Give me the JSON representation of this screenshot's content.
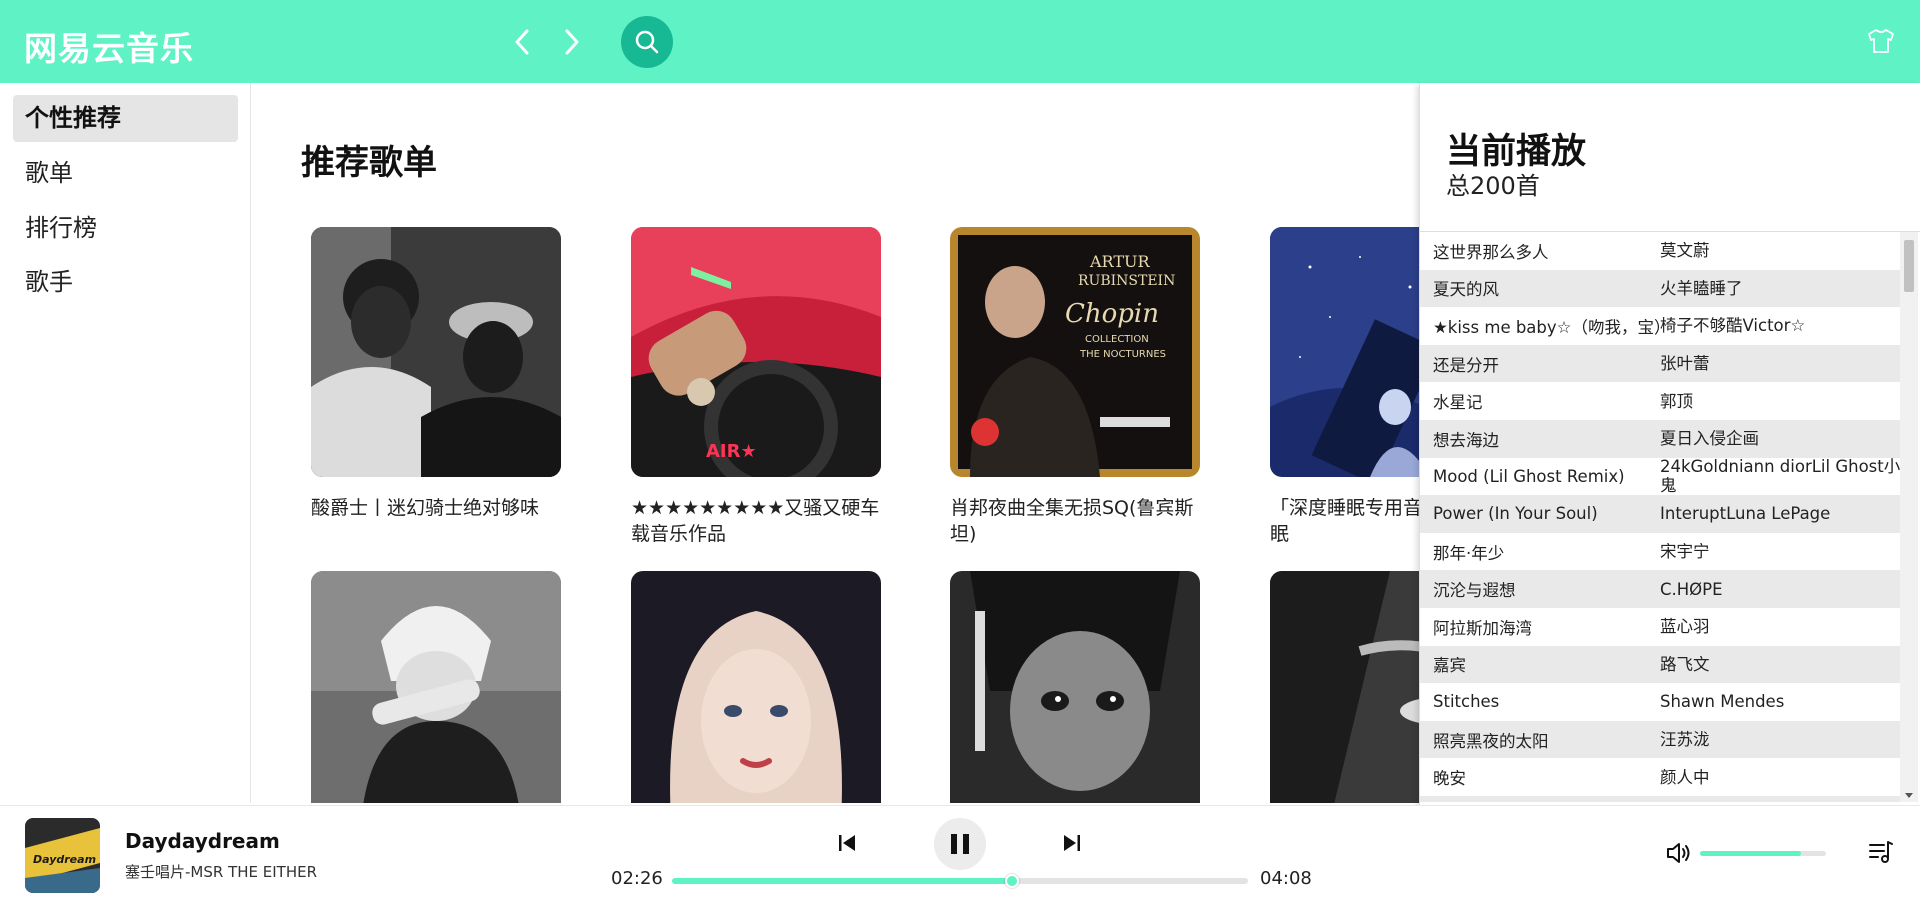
{
  "header": {
    "logo": "网易云音乐",
    "back_icon": "chevron-left-icon",
    "forward_icon": "chevron-right-icon",
    "search_icon": "search-icon",
    "skin_icon": "tshirt-icon",
    "bg_color": "#5ef2c4",
    "search_bg_color": "#17b995"
  },
  "sidebar": {
    "items": [
      {
        "label": "个性推荐",
        "active": true
      },
      {
        "label": "歌单",
        "active": false
      },
      {
        "label": "排行榜",
        "active": false
      },
      {
        "label": "歌手",
        "active": false
      }
    ]
  },
  "main": {
    "section_title": "推荐歌单",
    "playlists": [
      {
        "title": "酸爵士丨迷幻骑士绝对够味"
      },
      {
        "title": "★★★★★★★★★又骚又硬车载音乐作品"
      },
      {
        "title": "肖邦夜曲全集无损SQ(鲁宾斯坦)"
      },
      {
        "title": "「深度睡眠专用音效 自我催眠"
      },
      {
        "title": ""
      },
      {
        "title": ""
      },
      {
        "title": ""
      },
      {
        "title": ""
      }
    ]
  },
  "now_playing_panel": {
    "title": "当前播放",
    "count": "总200首",
    "songs": [
      {
        "name": "这世界那么多人",
        "artist": "莫文蔚"
      },
      {
        "name": "夏天的风",
        "artist": "火羊瞌睡了"
      },
      {
        "name": "★kiss me baby☆（吻我，宝）",
        "artist": "椅子不够酷Victor☆"
      },
      {
        "name": "还是分开",
        "artist": "张叶蕾"
      },
      {
        "name": "水星记",
        "artist": "郭顶"
      },
      {
        "name": "想去海边",
        "artist": "夏日入侵企画"
      },
      {
        "name": "Mood (Lil Ghost Remix)",
        "artist": "24kGoldniann diorLil Ghost小鬼"
      },
      {
        "name": "Power (In Your Soul)",
        "artist": "InteruptLuna LePage"
      },
      {
        "name": "那年·年少",
        "artist": "宋宇宁"
      },
      {
        "name": "沉沦与遐想",
        "artist": "C.HØPE"
      },
      {
        "name": "阿拉斯加海湾",
        "artist": "蓝心羽"
      },
      {
        "name": "嘉宾",
        "artist": "路飞文"
      },
      {
        "name": "Stitches",
        "artist": "Shawn Mendes"
      },
      {
        "name": "照亮黑夜的太阳",
        "artist": "汪苏泷"
      },
      {
        "name": "晚安",
        "artist": "颜人中"
      },
      {
        "name": "",
        "artist": ""
      }
    ]
  },
  "player": {
    "track_title": "Daydaydream",
    "track_artist": "塞壬唱片-MSR THE EITHER",
    "current_time": "02:26",
    "total_time": "04:08",
    "progress": 0.59,
    "volume": 0.8,
    "prev_icon": "skip-previous-icon",
    "pause_icon": "pause-icon",
    "next_icon": "skip-next-icon",
    "volume_icon": "volume-icon",
    "playlist_icon": "playlist-icon",
    "accent_color": "#5ef2c4"
  }
}
